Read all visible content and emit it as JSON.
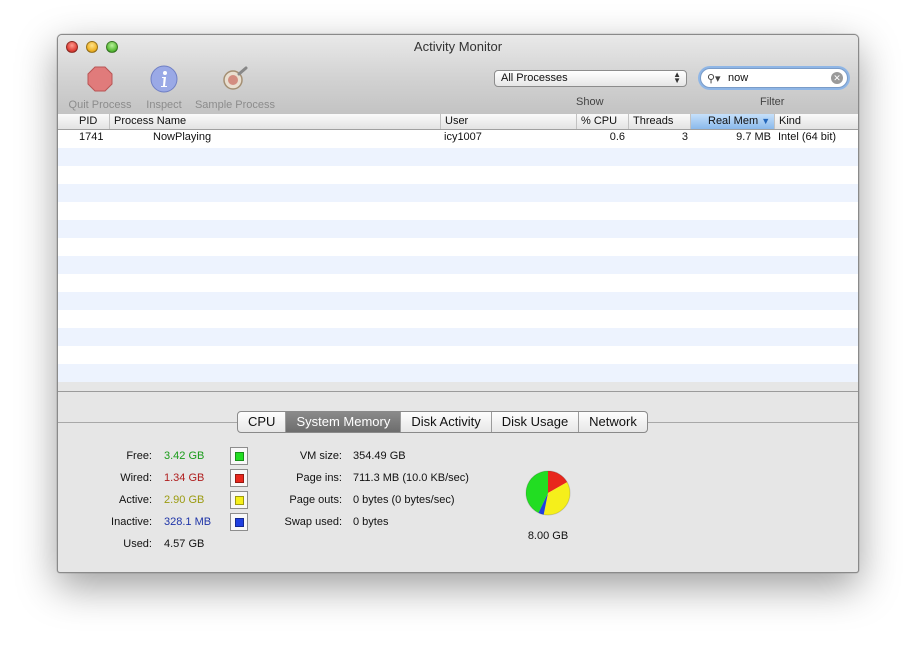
{
  "window": {
    "title": "Activity Monitor"
  },
  "toolbar": {
    "quit_label": "Quit Process",
    "inspect_label": "Inspect",
    "sample_label": "Sample Process",
    "show_label": "Show",
    "filter_label": "Filter",
    "process_filter": "All Processes",
    "search_value": "now"
  },
  "table": {
    "columns": [
      "PID",
      "Process Name",
      "User",
      "% CPU",
      "Threads",
      "Real Mem",
      "Kind"
    ],
    "sorted_column": "Real Mem",
    "rows": [
      {
        "pid": "1741",
        "name": "NowPlaying",
        "user": "icy1007",
        "cpu": "0.6",
        "threads": "3",
        "mem": "9.7 MB",
        "kind": "Intel (64 bit)"
      }
    ]
  },
  "tabs": [
    "CPU",
    "System Memory",
    "Disk Activity",
    "Disk Usage",
    "Network"
  ],
  "active_tab": "System Memory",
  "memory": {
    "free": {
      "label": "Free:",
      "value": "3.42 GB",
      "color": "#1a9c1a",
      "swatch": "#22dd22"
    },
    "wired": {
      "label": "Wired:",
      "value": "1.34 GB",
      "color": "#b01e1e",
      "swatch": "#e8271d"
    },
    "active": {
      "label": "Active:",
      "value": "2.90 GB",
      "color": "#9b9b10",
      "swatch": "#f5ef1b"
    },
    "inactive": {
      "label": "Inactive:",
      "value": "328.1 MB",
      "color": "#1f35a8",
      "swatch": "#1f3fe0"
    },
    "used": {
      "label": "Used:",
      "value": "4.57 GB"
    },
    "vm_size": {
      "label": "VM size:",
      "value": "354.49 GB"
    },
    "page_ins": {
      "label": "Page ins:",
      "value": "711.3 MB (10.0 KB/sec)"
    },
    "page_outs": {
      "label": "Page outs:",
      "value": "0 bytes (0 bytes/sec)"
    },
    "swap_used": {
      "label": "Swap used:",
      "value": "0 bytes"
    },
    "total": "8.00 GB"
  }
}
